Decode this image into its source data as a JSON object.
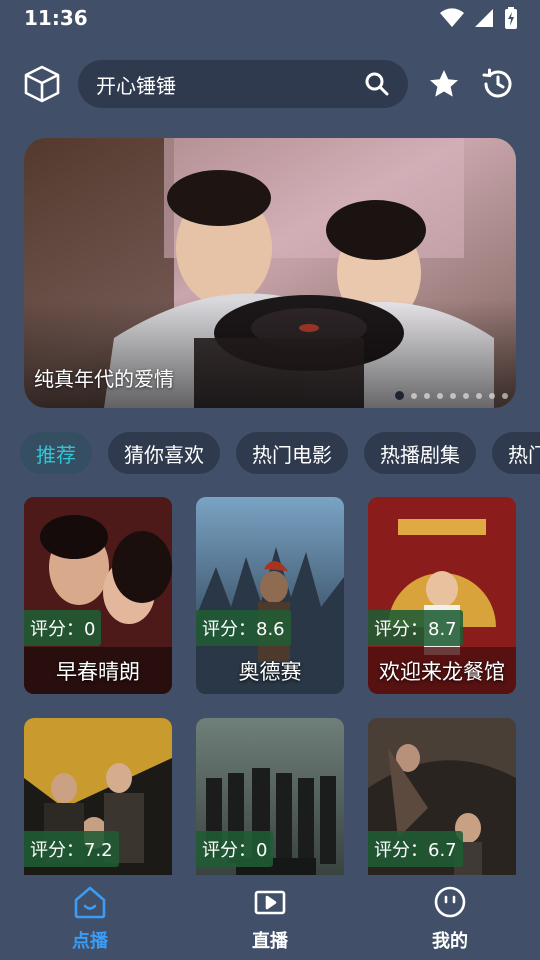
{
  "status_bar": {
    "time": "11:36",
    "icons": [
      "wifi-icon",
      "signal-icon",
      "battery-charging-icon"
    ]
  },
  "header": {
    "logo_icon": "cube-icon",
    "search": {
      "value": "开心锤锤",
      "icon": "search-icon"
    },
    "favorites_icon": "star-icon",
    "history_icon": "history-icon"
  },
  "banner": {
    "caption": "纯真年代的爱情",
    "dot_count": 9,
    "active_dot": 0
  },
  "tabs": [
    {
      "label": "推荐",
      "active": true
    },
    {
      "label": "猜你喜欢"
    },
    {
      "label": "热门电影"
    },
    {
      "label": "热播剧集"
    },
    {
      "label": "热门"
    }
  ],
  "movies": [
    {
      "title": "早春晴朗",
      "rating_label": "评分：0"
    },
    {
      "title": "奥德赛",
      "rating_label": "评分：8.6"
    },
    {
      "title": "欢迎来龙餐馆",
      "rating_label": "评分：8.7"
    },
    {
      "title": "",
      "rating_label": "评分：7.2"
    },
    {
      "title": "",
      "rating_label": "评分：0"
    },
    {
      "title": "",
      "rating_label": "评分：6.7"
    }
  ],
  "bottom_nav": [
    {
      "label": "点播",
      "icon": "home-icon",
      "active": true
    },
    {
      "label": "直播",
      "icon": "play-icon"
    },
    {
      "label": "我的",
      "icon": "profile-icon"
    }
  ],
  "colors": {
    "background": "#415068",
    "surface": "#2f3a4e",
    "active_tab_text": "#2fc5d8",
    "active_nav": "#3b9cf5",
    "rating_badge": "#205c34"
  }
}
